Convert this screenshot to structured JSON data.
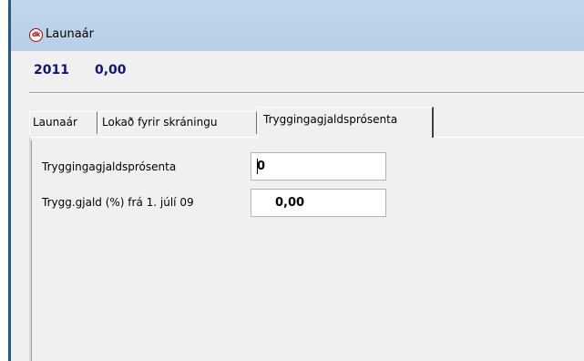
{
  "window": {
    "title": "Launaár",
    "icon": "dk-app-icon",
    "icon_text": "dk"
  },
  "summary": {
    "year": "2011",
    "value": "0,00"
  },
  "tabs": [
    {
      "label": "Launaár",
      "active": false
    },
    {
      "label": "Lokað fyrir skráningu",
      "active": false
    },
    {
      "label": "Tryggingagjaldsprósenta",
      "active": true
    }
  ],
  "form": {
    "percentage_label": "Tryggingagjaldsprósenta",
    "percentage_value": "0",
    "from_date_label": "Trygg.gjald (%) frá 1. júlí 09",
    "from_date_value": "0,00"
  },
  "colors": {
    "title_bar": "#bcd2e9",
    "summary_text": "#14147a",
    "window_body": "#f0f0f0"
  }
}
